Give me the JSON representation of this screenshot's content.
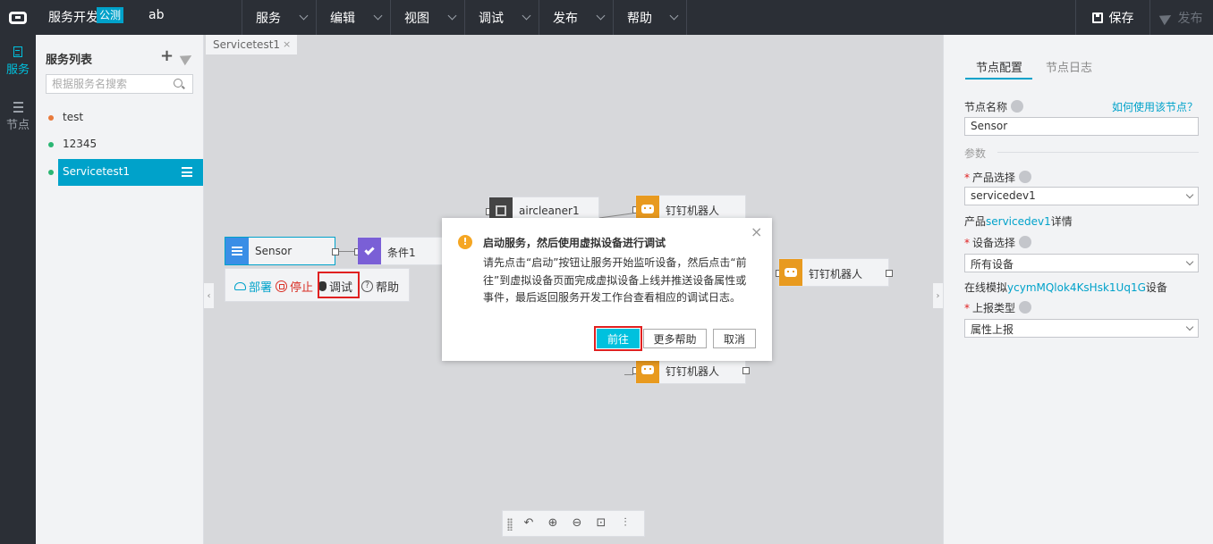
{
  "topbar": {
    "app_title": "服务开发",
    "badge": "公测",
    "project": "ab",
    "menu": [
      "服务",
      "编辑",
      "视图",
      "调试",
      "发布",
      "帮助"
    ],
    "save": "保存",
    "publish": "发布"
  },
  "leftnav": {
    "services": "服务",
    "nodes": "节点"
  },
  "service_list": {
    "title": "服务列表",
    "search_placeholder": "根据服务名搜索",
    "items": [
      {
        "name": "test",
        "status_color": "#e8793a"
      },
      {
        "name": "12345",
        "status_color": "#2bb673"
      },
      {
        "name": "Servicetest1",
        "status_color": "#2bb673"
      }
    ]
  },
  "canvas": {
    "tab": "Servicetest1",
    "nodes": {
      "sensor": "Sensor",
      "condition": "条件1",
      "device": "aircleaner1",
      "robot_top": "钉钉机器人",
      "robot_mid": "钉钉机器人",
      "robot_bottom": "钉钉机器人"
    },
    "ops": {
      "deploy": "部署",
      "stop": "停止",
      "debug": "调试",
      "help": "帮助"
    }
  },
  "props": {
    "tab_config": "节点配置",
    "tab_log": "节点日志",
    "node_name_label": "节点名称",
    "how_to_link": "如何使用该节点？",
    "node_name_value": "Sensor",
    "params_label": "参数",
    "product_label": "产品选择",
    "product_value": "servicedev1",
    "product_detail_prefix": "产品",
    "product_detail_link": "servicedev1",
    "product_detail_suffix": "详情",
    "device_label": "设备选择",
    "device_value": "所有设备",
    "device_sim_prefix": "在线模拟",
    "device_sim_link": "ycymMQlok4KsHsk1Uq1G",
    "device_sim_suffix": "设备",
    "report_label": "上报类型",
    "report_value": "属性上报"
  },
  "dialog": {
    "title": "启动服务，然后使用虚拟设备进行调试",
    "body": "请先点击“启动”按钮让服务开始监听设备，然后点击“前往”到虚拟设备页面完成虚拟设备上线并推送设备属性或事件，最后返回服务开发工作台查看相应的调试日志。",
    "go": "前往",
    "more_help": "更多帮助",
    "cancel": "取消"
  }
}
